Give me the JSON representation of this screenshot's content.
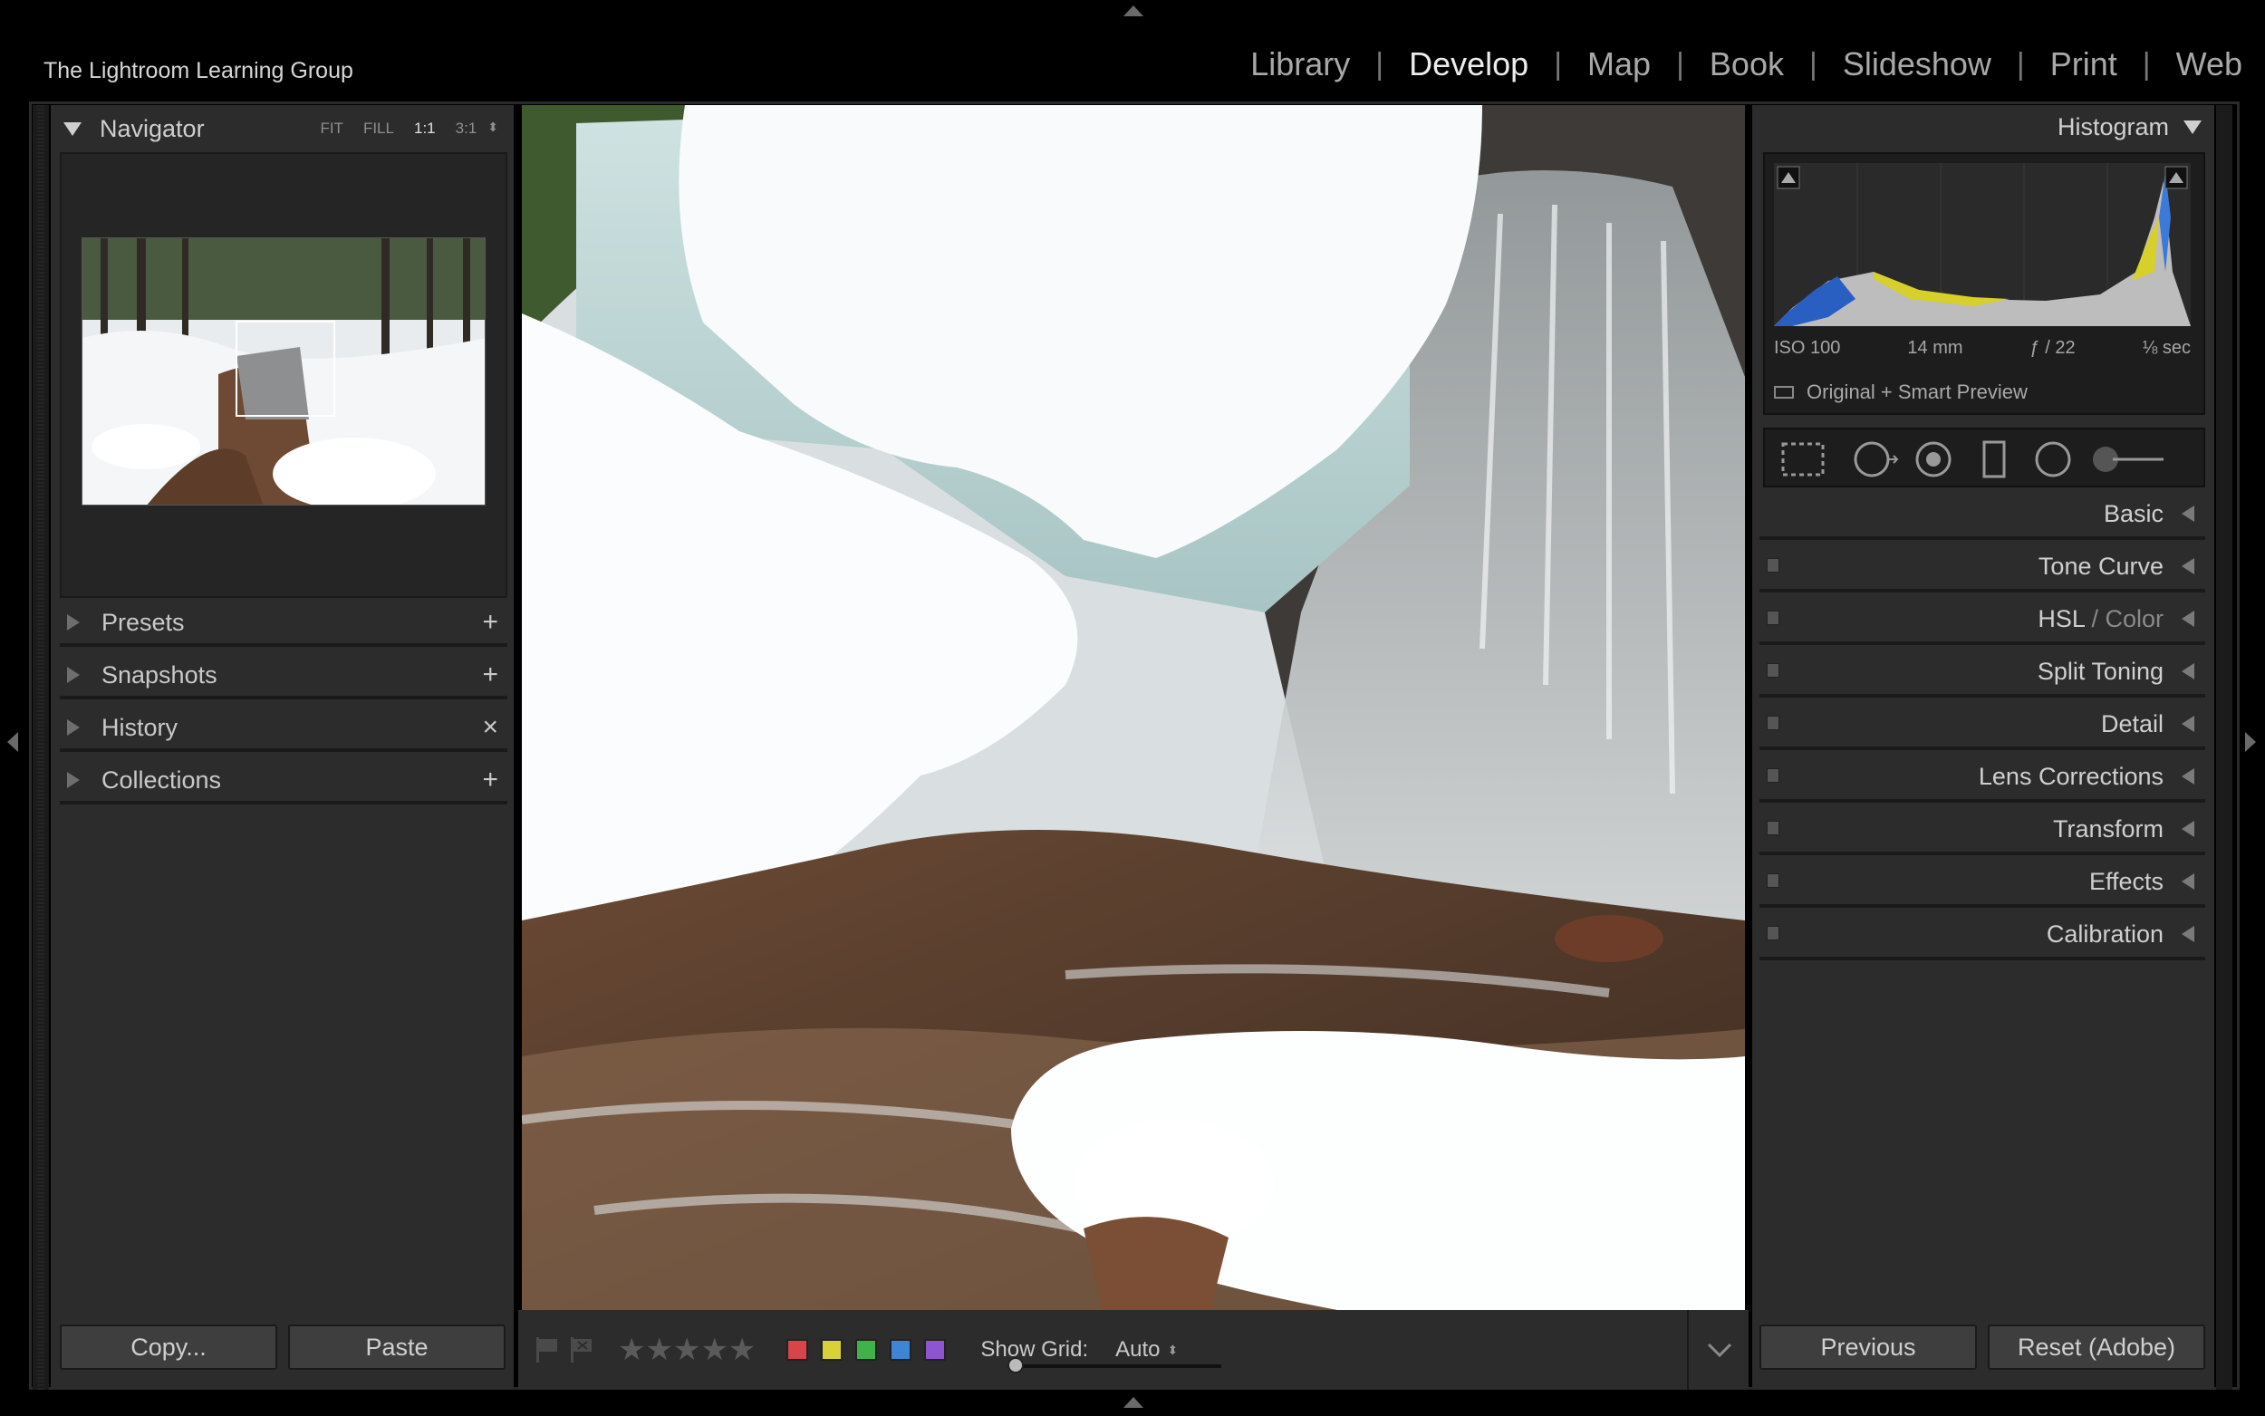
{
  "app": {
    "brand": "The Lightroom Learning Group"
  },
  "modules": [
    {
      "label": "Library",
      "active": false
    },
    {
      "label": "Develop",
      "active": true
    },
    {
      "label": "Map",
      "active": false
    },
    {
      "label": "Book",
      "active": false
    },
    {
      "label": "Slideshow",
      "active": false
    },
    {
      "label": "Print",
      "active": false
    },
    {
      "label": "Web",
      "active": false
    }
  ],
  "navigator": {
    "title": "Navigator",
    "zoom_options": [
      "FIT",
      "FILL",
      "1:1",
      "3:1"
    ],
    "zoom_active": "1:1"
  },
  "left_sections": {
    "presets": {
      "label": "Presets",
      "action": "+"
    },
    "snapshots": {
      "label": "Snapshots",
      "action": "+"
    },
    "history": {
      "label": "History",
      "action": "×"
    },
    "collections": {
      "label": "Collections",
      "action": "+"
    }
  },
  "left_buttons": {
    "copy": "Copy...",
    "paste": "Paste"
  },
  "toolbar": {
    "stars": "★★★★★",
    "show_grid_label": "Show Grid:",
    "show_grid_value": "Auto",
    "color_labels": [
      "#d9434a",
      "#d8d235",
      "#3fb34a",
      "#3f85d6",
      "#8f55d1"
    ]
  },
  "histogram": {
    "title": "Histogram",
    "iso": "ISO 100",
    "focal": "14 mm",
    "aperture": "ƒ / 22",
    "shutter": "⅛ sec",
    "preview": "Original + Smart Preview"
  },
  "right_sections": {
    "basic": "Basic",
    "tone_curve": "Tone Curve",
    "hsl": "HSL",
    "hsl_sep": " / ",
    "color": "Color",
    "split_toning": "Split Toning",
    "detail": "Detail",
    "lens": "Lens Corrections",
    "transform": "Transform",
    "effects": "Effects",
    "calibration": "Calibration"
  },
  "right_buttons": {
    "previous": "Previous",
    "reset": "Reset (Adobe)"
  }
}
